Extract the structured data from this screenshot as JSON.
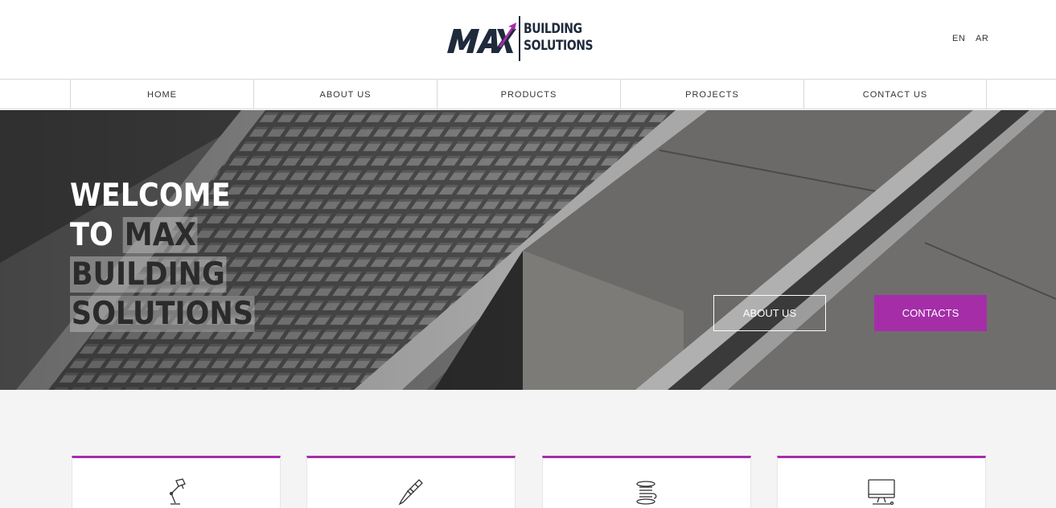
{
  "header": {
    "logo": {
      "mark": "MAX",
      "line1": "BUILDING",
      "line2": "SOLUTIONS"
    },
    "languages": [
      "EN",
      "AR"
    ]
  },
  "nav": {
    "items": [
      {
        "label": "HOME"
      },
      {
        "label": "ABOUT US"
      },
      {
        "label": "PRODUCTS"
      },
      {
        "label": "PROJECTS"
      },
      {
        "label": "CONTACT US"
      }
    ]
  },
  "hero": {
    "title_line1": "WELCOME",
    "title_line2_a": "TO ",
    "title_line2_b": "MAX",
    "title_line3": "BUILDING",
    "title_line4": "SOLUTIONS",
    "about_button": "ABOUT US",
    "contacts_button": "CONTACTS"
  },
  "features": {
    "cards": [
      {
        "icon": "desk-lamp-icon"
      },
      {
        "icon": "screwdriver-icon"
      },
      {
        "icon": "cable-spool-icon"
      },
      {
        "icon": "computer-monitor-icon"
      }
    ]
  },
  "colors": {
    "accent": "#a52ea8",
    "brand_dark": "#1f2a3d",
    "background_light": "#f4f4f4"
  }
}
